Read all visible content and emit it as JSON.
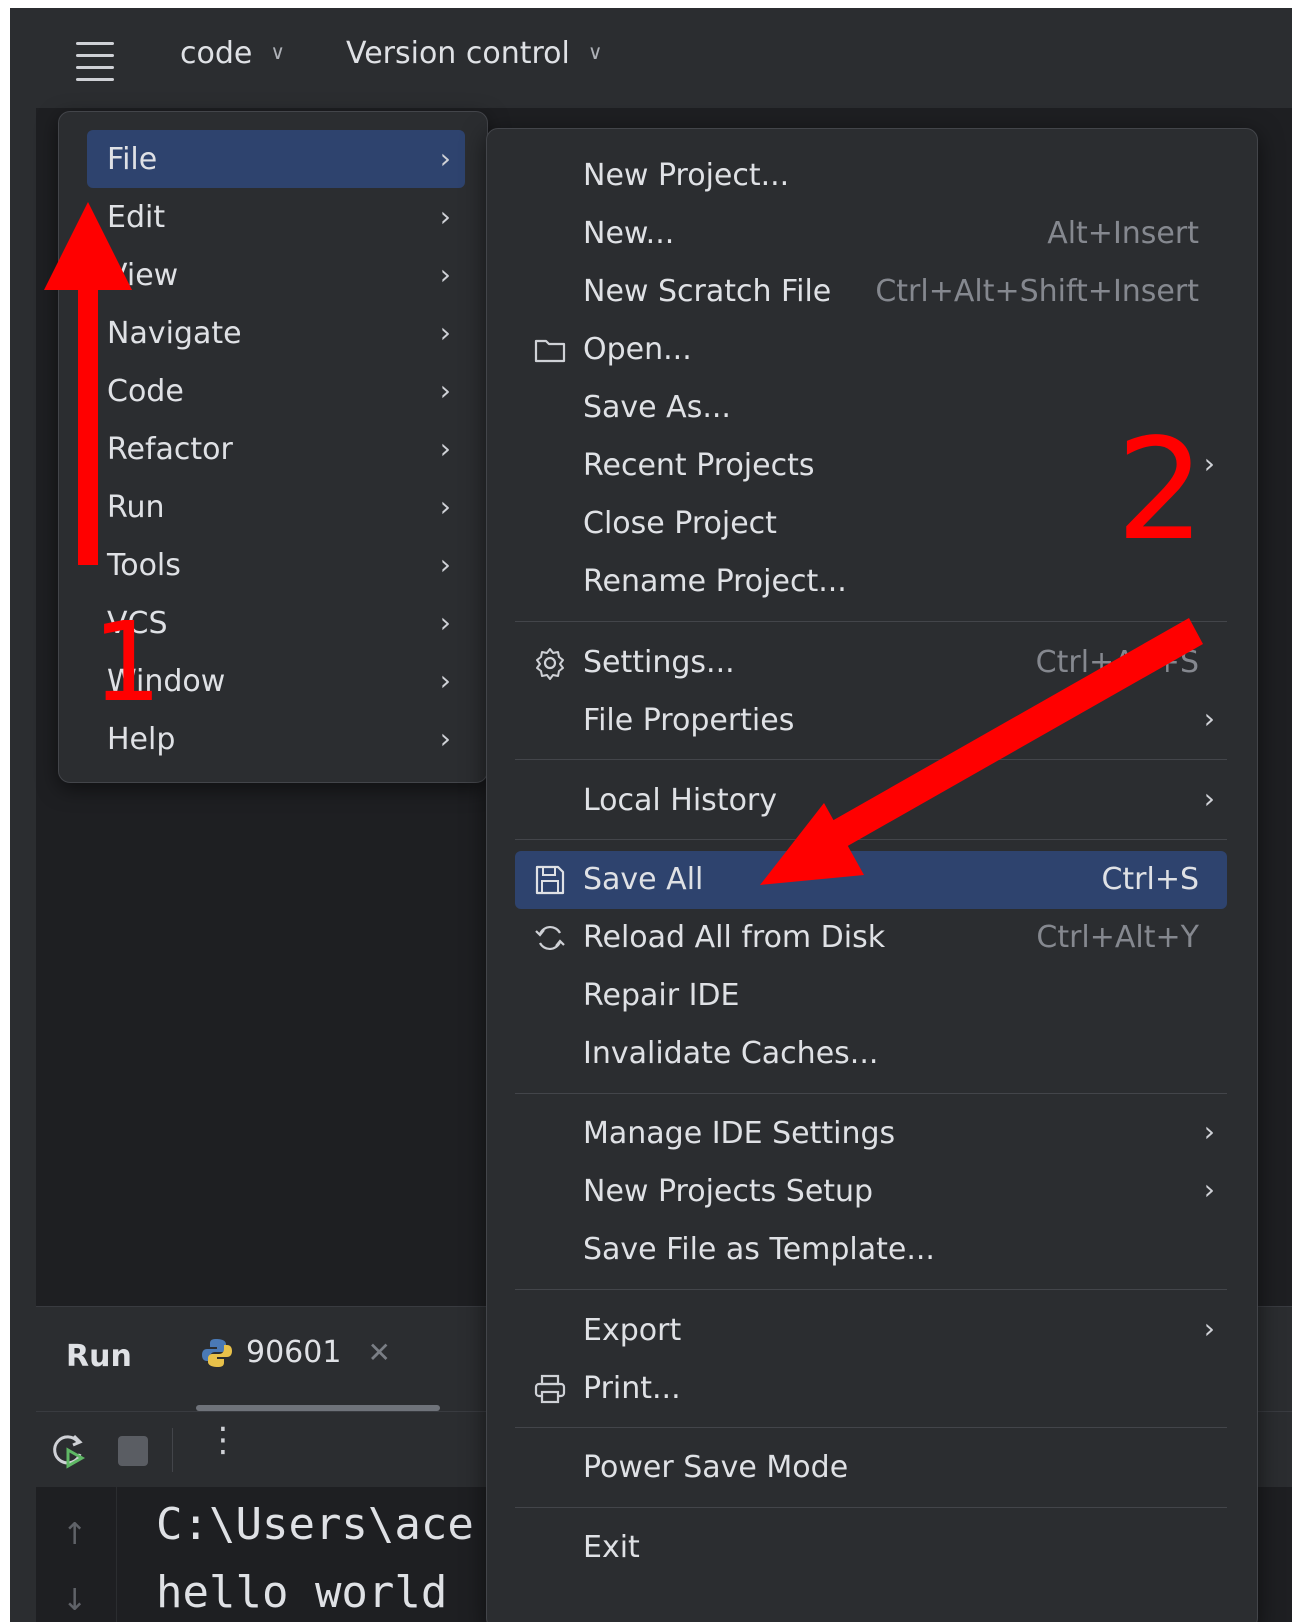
{
  "topbar": {
    "menu_icon": "hamburger-icon",
    "project_label": "code",
    "vcs_label": "Version control"
  },
  "main_menu": {
    "items": [
      {
        "label": "File",
        "selected": true
      },
      {
        "label": "Edit"
      },
      {
        "label": "View"
      },
      {
        "label": "Navigate"
      },
      {
        "label": "Code"
      },
      {
        "label": "Refactor"
      },
      {
        "label": "Run"
      },
      {
        "label": "Tools"
      },
      {
        "label": "VCS"
      },
      {
        "label": "Window"
      },
      {
        "label": "Help"
      }
    ]
  },
  "file_menu": {
    "items": [
      {
        "label": "New Project..."
      },
      {
        "label": "New...",
        "shortcut": "Alt+Insert"
      },
      {
        "label": "New Scratch File",
        "shortcut": "Ctrl+Alt+Shift+Insert"
      },
      {
        "label": "Open...",
        "icon": "folder-icon"
      },
      {
        "label": "Save As..."
      },
      {
        "label": "Recent Projects",
        "submenu": true
      },
      {
        "label": "Close Project"
      },
      {
        "label": "Rename Project..."
      },
      {
        "label": "Settings...",
        "icon": "gear-icon",
        "shortcut": "Ctrl+Alt+S"
      },
      {
        "label": "File Properties",
        "submenu": true
      },
      {
        "label": "Local History",
        "submenu": true
      },
      {
        "label": "Save All",
        "icon": "save-icon",
        "shortcut": "Ctrl+S",
        "selected": true
      },
      {
        "label": "Reload All from Disk",
        "icon": "reload-icon",
        "shortcut": "Ctrl+Alt+Y"
      },
      {
        "label": "Repair IDE"
      },
      {
        "label": "Invalidate Caches..."
      },
      {
        "label": "Manage IDE Settings",
        "submenu": true
      },
      {
        "label": "New Projects Setup",
        "submenu": true
      },
      {
        "label": "Save File as Template..."
      },
      {
        "label": "Export",
        "submenu": true
      },
      {
        "label": "Print...",
        "icon": "printer-icon"
      },
      {
        "label": "Power Save Mode"
      },
      {
        "label": "Exit"
      }
    ]
  },
  "run_panel": {
    "title": "Run",
    "tab_label": "90601",
    "console_lines": [
      "C:\\Users\\ace",
      "hello world"
    ]
  },
  "annotations": {
    "step1_label": "1",
    "step2_label": "2",
    "color": "#ff0000"
  },
  "colors": {
    "selection": "#2e436e",
    "menu_bg": "#2b2d30",
    "editor_bg": "#1e1f22"
  }
}
